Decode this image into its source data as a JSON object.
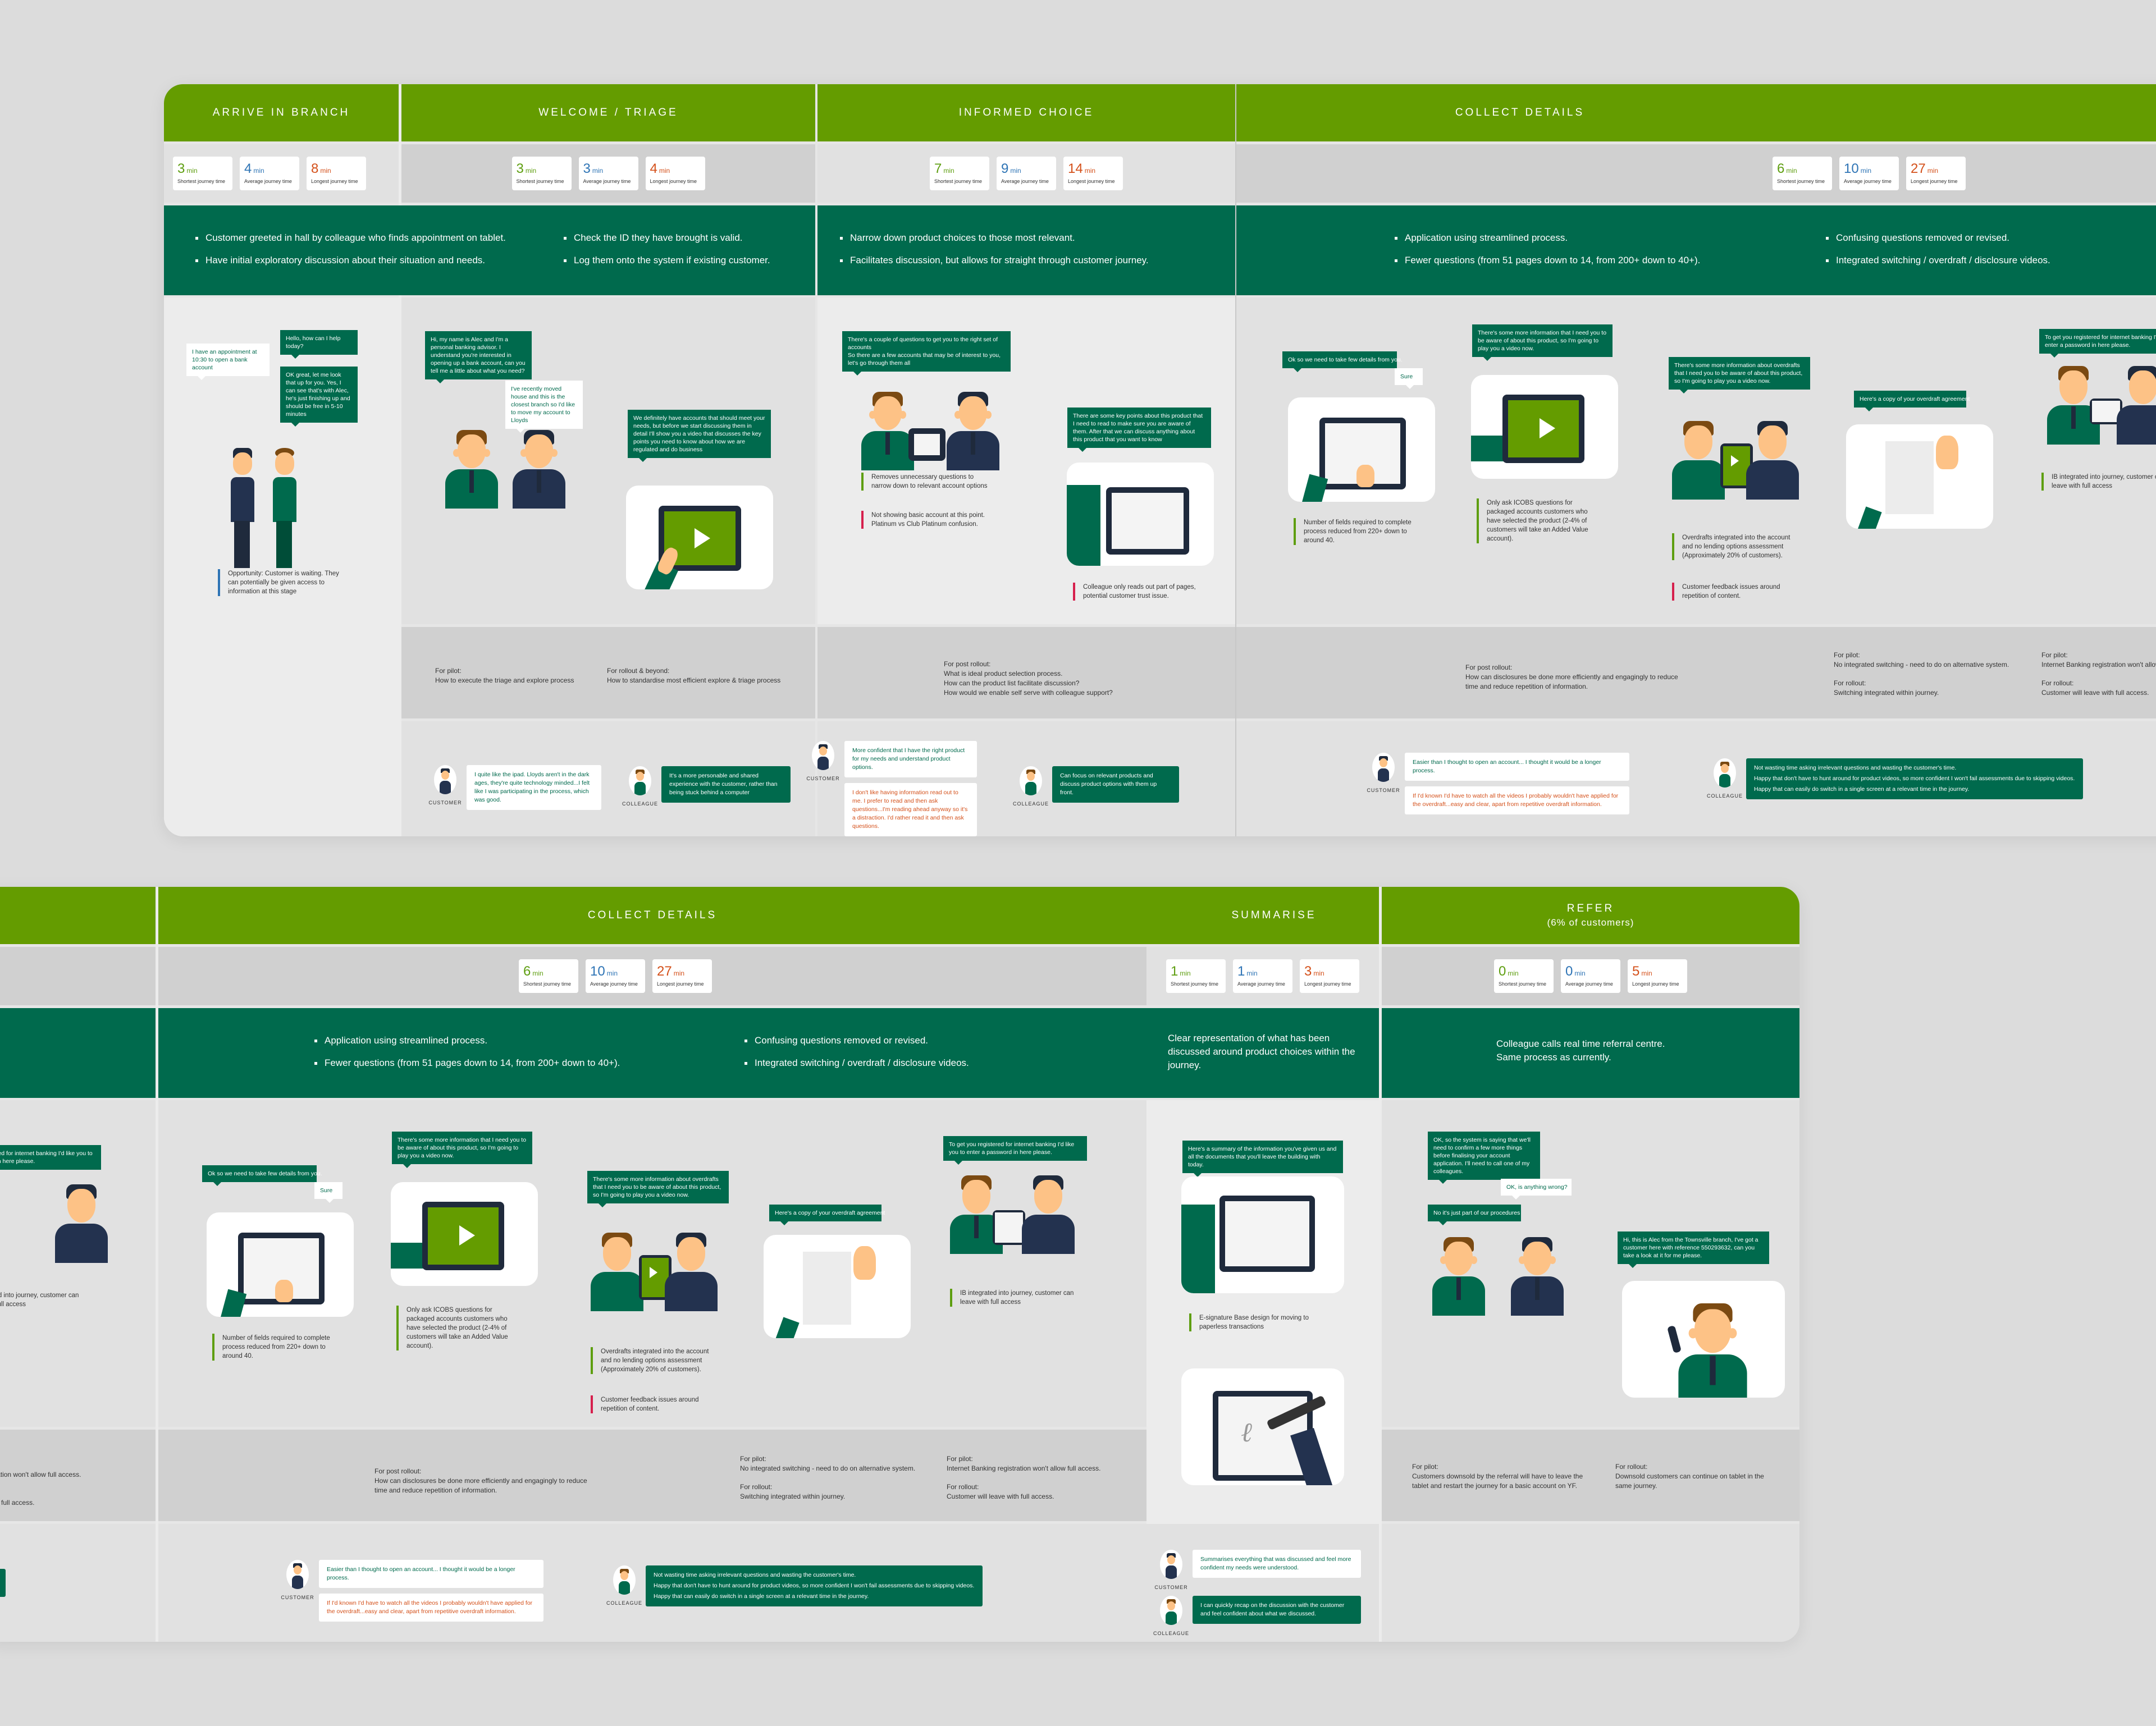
{
  "timer_labels": {
    "unit": "min",
    "shortest": "Shortest journey time",
    "average": "Average journey time",
    "longest": "Longest journey time"
  },
  "colors": {
    "header_green": "#649c00",
    "summary_green": "#006a4d",
    "shortest": "#5e9e10",
    "average": "#2e74b5",
    "longest": "#d4501a",
    "positive_note": "#5e9e10",
    "negative_note": "#d6204d",
    "opportunity_note": "#2e74b5"
  },
  "speakers": {
    "customer": "CUSTOMER",
    "colleague": "COLLEAGUE"
  },
  "top_panel": {
    "stages": [
      {
        "title": "ARRIVE IN BRANCH",
        "timers": {
          "shortest": "3",
          "average": "4",
          "longest": "8"
        },
        "summary": [
          "Customer greeted in hall by colleague who finds appointment on tablet.",
          "Have initial exploratory discussion about their situation and needs."
        ],
        "bubbles": [
          "Hello, how can I help today?",
          "I have an appointment at 10:30 to open a bank account",
          "OK great, let me look that up for you. Yes, I can see that's with Alec, he's just finishing up and should be free in 5-10 minutes"
        ],
        "notes": [
          {
            "type": "opportunity",
            "text": "Opportunity: Customer is waiting. They can potentially be given access to information at this stage"
          }
        ]
      },
      {
        "title": "WELCOME / TRIAGE",
        "timers": {
          "shortest": "3",
          "average": "3",
          "longest": "4"
        },
        "summary": [
          "Check the ID they have brought is valid.",
          "Log them onto the system if existing customer."
        ],
        "bubbles": [
          "Hi, my name is Alec and I'm a personal banking advisor. I understand you're interested in opening up a bank account, can you tell me a little about what you need?",
          "I've recently moved house and this is the closest branch so I'd like to move my account to Lloyds",
          "We definitely have accounts that should meet your needs, but before we start discussing them in detail I'll show you a video that discusses the key points you need to know about how we are regulated and do business"
        ],
        "pilot": [
          {
            "heading": "For pilot:",
            "lines": [
              "How to execute the triage and explore process"
            ]
          },
          {
            "heading": "For rollout & beyond:",
            "lines": [
              "How to standardise most efficient explore & triage process"
            ]
          }
        ],
        "feedback": [
          {
            "speaker": "customer",
            "messages": [
              {
                "tone": "positive",
                "text": "I quite like the ipad. Lloyds aren't in the dark ages, they're quite technology minded...I felt like I was participating in the process, which was good."
              }
            ]
          },
          {
            "speaker": "colleague",
            "messages": [
              {
                "tone": "colleague",
                "text": "It's a more personable and shared experience with the customer, rather than being stuck behind a computer"
              }
            ]
          }
        ]
      },
      {
        "title": "INFORMED CHOICE",
        "timers": {
          "shortest": "7",
          "average": "9",
          "longest": "14"
        },
        "summary": [
          "Narrow down product choices to those most relevant.",
          "Facilitates discussion, but allows for straight through customer journey."
        ],
        "bubbles": [
          "There's a couple of questions to get you to the right set of accounts",
          "So there are a few accounts that may be of interest to you, let's go through them all",
          "There are some key points about this product that I need to read to make sure you are aware of them. After that we can discuss anything about this product that you want to know"
        ],
        "notes": [
          {
            "type": "positive",
            "text": "Removes unnecessary questions to narrow down to relevant account options"
          },
          {
            "type": "negative",
            "text": "Not showing basic account at this point. Platinum vs Club Platinum confusion."
          },
          {
            "type": "negative",
            "text": "Colleague only reads out part of pages, potential customer trust issue."
          }
        ],
        "pilot": [
          {
            "heading": "For post rollout:",
            "lines": [
              "What is ideal product selection process.",
              "How can the product list facilitate discussion?",
              "How would we enable self serve with colleague support?"
            ]
          }
        ],
        "feedback": [
          {
            "speaker": "customer",
            "messages": [
              {
                "tone": "positive",
                "text": "More confident that I have the right product for my needs and understand product options."
              },
              {
                "tone": "negative",
                "text": "I don't like having information read out to me. I prefer to read and then ask questions...I'm reading ahead anyway so it's a distraction. I'd rather read it and then ask questions."
              }
            ]
          },
          {
            "speaker": "colleague",
            "messages": [
              {
                "tone": "colleague",
                "text": "Can focus on relevant products and discuss product options with them up front."
              }
            ]
          }
        ]
      },
      {
        "title": "COLLECT DETAILS",
        "timers": {
          "shortest": "6",
          "average": "10",
          "longest": "27"
        },
        "summary_left": [
          "Application using streamlined process.",
          "Fewer questions (from 51 pages down to 14, from 200+ down to 40+)."
        ],
        "summary_right": [
          "Confusing questions removed or revised.",
          "Integrated switching / overdraft / disclosure videos."
        ],
        "bubbles": {
          "details": "Ok so we need to take few details from you.",
          "sure": "Sure",
          "video": "There's some more information that I need you to be aware of about this product, so I'm going to play you a video now.",
          "overdraft_video": "There's some more information about overdrafts that I need you to be aware of about this product, so I'm going to play you a video now.",
          "agreement": "Here's a copy of your overdraft agreement",
          "internet_banking": "To get you registered for internet banking I'd like you to enter a password in here please."
        },
        "notes": {
          "fields": "Number of fields required to complete process reduced from 220+ down to around 40.",
          "icobs": "Only ask ICOBS questions for packaged accounts customers who have selected the product (2-4% of customers will take an Added Value account).",
          "overdrafts": "Overdrafts integrated into the account and no lending options assessment (Approximately 20% of customers).",
          "repetition": "Customer feedback issues around repetition of content.",
          "ib": "IB integrated into journey, customer can leave with full access"
        },
        "pilot": {
          "post_rollout": {
            "heading": "For post rollout:",
            "lines": [
              "How can disclosures be done more efficiently and engagingly to reduce time and reduce repetition of information."
            ]
          },
          "switching": [
            {
              "heading": "For pilot:",
              "lines": [
                "No integrated switching - need to do on alternative system."
              ]
            },
            {
              "heading": "For rollout:",
              "lines": [
                "Switching integrated within journey."
              ]
            }
          ],
          "ib": [
            {
              "heading": "For pilot:",
              "lines": [
                "Internet Banking registration won't allow full access."
              ]
            },
            {
              "heading": "For rollout:",
              "lines": [
                "Customer will leave with full access."
              ]
            }
          ]
        },
        "feedback": [
          {
            "speaker": "customer",
            "messages": [
              {
                "tone": "positive",
                "text": "Easier than I thought to open an account... I thought it would be a longer process."
              },
              {
                "tone": "negative",
                "text": "If I'd known I'd have to watch all the videos I probably wouldn't have applied for the overdraft...easy and clear, apart from repetitive overdraft information."
              }
            ]
          },
          {
            "speaker": "colleague",
            "messages": [
              {
                "tone": "colleague",
                "text": "Not wasting time asking irrelevant questions and wasting the customer's time."
              },
              {
                "tone": "colleague",
                "text": "Happy that don't have to hunt around for product videos, so more confident I won't fail assessments due to skipping videos."
              },
              {
                "tone": "colleague",
                "text": "Happy that can easily do switch in a single screen at a relevant time in the journey."
              }
            ]
          }
        ]
      }
    ]
  },
  "bottom_panel": {
    "summarise": {
      "title": "SUMMARISE",
      "timers": {
        "shortest": "1",
        "average": "1",
        "longest": "3"
      },
      "summary": "Clear representation of what has been discussed around product choices within the journey.",
      "bubble": "Here's a summary of the information you've given us and all the documents that you'll leave the building with today.",
      "note": "E-signature Base design for moving to paperless transactions",
      "feedback": [
        {
          "speaker": "customer",
          "tone": "positive",
          "text": "Summarises everything that was discussed and feel more confident my needs were understood."
        },
        {
          "speaker": "colleague",
          "tone": "colleague",
          "text": "I can quickly recap on the discussion with the customer and feel confident about what we discussed."
        }
      ]
    },
    "refer": {
      "title": "REFER",
      "subtitle": "(6% of customers)",
      "timers": {
        "shortest": "0",
        "average": "0",
        "longest": "5"
      },
      "summary": [
        "Colleague calls real time referral centre.",
        "Same process as currently."
      ],
      "bubbles": {
        "system": "OK, so the system is saying that we'll need to confirm a few more things before finalising your account application. I'll need to call one of my colleagues.",
        "wrong": "OK, is anything wrong?",
        "procedures": "No it's just part of our procedures",
        "call": "Hi, this is Alec from the Townsville branch, I've got a customer here with reference 550293632, can you take a look at it for me please."
      },
      "pilot": [
        {
          "heading": "For pilot:",
          "lines": [
            "Customers downsold by the referral will have to leave the tablet and restart the journey for a basic account on YF."
          ]
        },
        {
          "heading": "For rollout:",
          "lines": [
            "Downsold customers can continue on tablet in the same journey."
          ]
        }
      ]
    }
  }
}
